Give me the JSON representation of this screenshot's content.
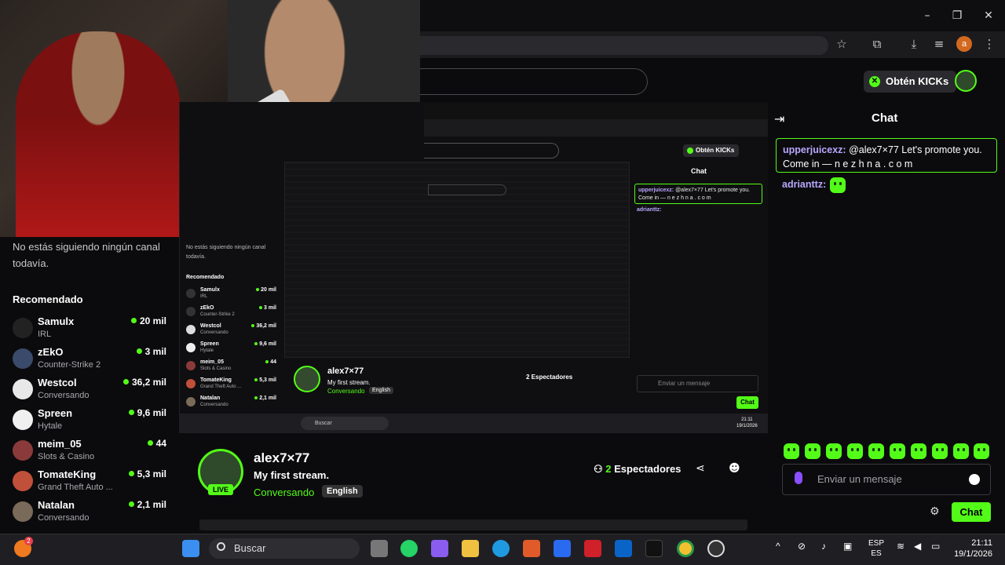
{
  "browser": {
    "window_controls": {
      "minimize": "–",
      "maximize": "❐",
      "close": "✕"
    },
    "profile_initial": "a"
  },
  "header": {
    "kicks_button": "Obtén KICKs"
  },
  "sidebar": {
    "no_follow_text": "No estás siguiendo ningún canal todavía.",
    "recommended_title": "Recomendado",
    "channels": [
      {
        "name": "Samulx",
        "category": "IRL",
        "viewers": "20 mil"
      },
      {
        "name": "zEkO",
        "category": "Counter-Strike 2",
        "viewers": "3 mil"
      },
      {
        "name": "Westcol",
        "category": "Conversando",
        "viewers": "36,2 mil"
      },
      {
        "name": "Spreen",
        "category": "Hytale",
        "viewers": "9,6 mil"
      },
      {
        "name": "meim_05",
        "category": "Slots & Casino",
        "viewers": "44"
      },
      {
        "name": "TomateKing",
        "category": "Grand Theft Auto ...",
        "viewers": "5,3 mil"
      },
      {
        "name": "Natalan",
        "category": "Conversando",
        "viewers": "2,1 mil"
      }
    ]
  },
  "nested": {
    "kicks_button": "Obtén KICKs",
    "chat_title": "Chat",
    "pinned_user": "upperjuicexz:",
    "pinned_text": "@alex7×77 Let's promote you. Come in — n e z h n a . c o m",
    "second_user": "adrianttz:",
    "no_follow_text": "No estás siguiendo ningún canal todavía.",
    "recommended_title": "Recomendado",
    "channels": [
      {
        "name": "Samulx",
        "category": "IRL",
        "viewers": "20 mil"
      },
      {
        "name": "zEkO",
        "category": "Counter-Strike 2",
        "viewers": "3 mil"
      },
      {
        "name": "Westcol",
        "category": "Conversando",
        "viewers": "36,2 mil"
      },
      {
        "name": "Spreen",
        "category": "Hytale",
        "viewers": "9,6 mil"
      },
      {
        "name": "meim_05",
        "category": "Slots & Casino",
        "viewers": "44"
      },
      {
        "name": "TomateKing",
        "category": "Grand Theft Auto ...",
        "viewers": "5,3 mil"
      },
      {
        "name": "Natalan",
        "category": "Conversando",
        "viewers": "2,1 mil"
      }
    ],
    "channel_name": "alex7×77",
    "stream_title": "My first stream.",
    "category": "Conversando",
    "language": "English",
    "viewers": "2 Espectadores",
    "input_placeholder": "Enviar un mensaje",
    "chat_button": "Chat",
    "taskbar_search": "Buscar",
    "clock_time": "21:11",
    "clock_date": "19/1/2026"
  },
  "chat": {
    "title": "Chat",
    "messages": [
      {
        "user": "upperjuicexz:",
        "text": "@alex7×77 Let's promote you. Come in — n e z h n a . c o m"
      },
      {
        "user": "adrianttz:",
        "text": ""
      }
    ],
    "input_placeholder": "Enviar un mensaje",
    "send_button": "Chat"
  },
  "stream": {
    "channel_name": "alex7×77",
    "title": "My first stream.",
    "category": "Conversando",
    "language": "English",
    "live_badge": "LIVE",
    "viewers_count": "2",
    "viewers_label": "Espectadores"
  },
  "taskbar": {
    "search_placeholder": "Buscar",
    "notification_badge": "2",
    "language": "ESP",
    "region": "ES",
    "time": "21:11",
    "date": "19/1/2026"
  },
  "colors": {
    "accent": "#53fc18",
    "username": "#b9a7ff",
    "background": "#0b0b0d"
  }
}
